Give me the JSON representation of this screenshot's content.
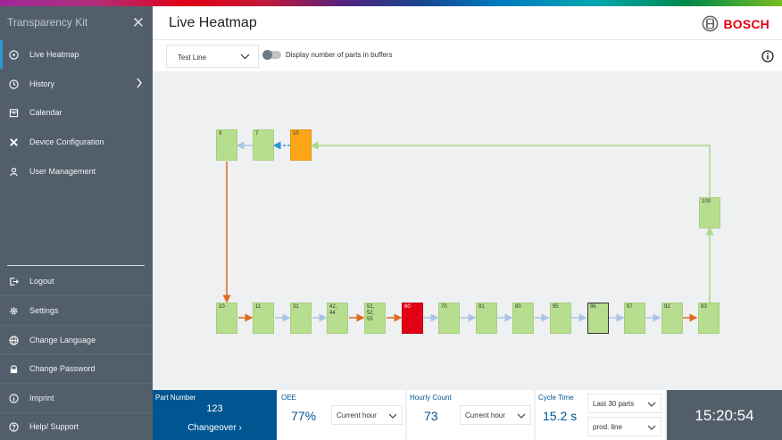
{
  "sidebar": {
    "title": "Transparency Kit",
    "items": [
      {
        "label": "Live Heatmap"
      },
      {
        "label": "History"
      },
      {
        "label": "Calendar"
      },
      {
        "label": "Device Configuration"
      },
      {
        "label": "User Management"
      }
    ],
    "bottom_items": [
      {
        "label": "Logout"
      },
      {
        "label": "Settings"
      },
      {
        "label": "Change Language"
      },
      {
        "label": "Change Password"
      },
      {
        "label": "Imprint"
      },
      {
        "label": "Help/ Support"
      }
    ]
  },
  "header": {
    "title": "Live Heatmap",
    "brand": "BOSCH"
  },
  "toolbar": {
    "line_select": "Test Line",
    "toggle_label": "Display number of parts in buffers",
    "toggle_on": false
  },
  "heatmap": {
    "stations": [
      {
        "label": "9",
        "status": "ok"
      },
      {
        "label": "7",
        "status": "ok"
      },
      {
        "label": "10",
        "status": "warning"
      },
      {
        "label": "100",
        "status": "ok"
      },
      {
        "label": "10",
        "status": "ok"
      },
      {
        "label": "11",
        "status": "ok"
      },
      {
        "label": "31",
        "status": "ok"
      },
      {
        "label": "42,\n44",
        "status": "ok"
      },
      {
        "label": "51,\n52,\n55",
        "status": "ok"
      },
      {
        "label": "60",
        "status": "error"
      },
      {
        "label": "70",
        "status": "ok"
      },
      {
        "label": "91",
        "status": "ok"
      },
      {
        "label": "80",
        "status": "ok"
      },
      {
        "label": "95",
        "status": "ok"
      },
      {
        "label": "96",
        "status": "selected"
      },
      {
        "label": "97",
        "status": "ok"
      },
      {
        "label": "92",
        "status": "ok"
      },
      {
        "label": "93",
        "status": "ok"
      }
    ],
    "colors": {
      "ok": "#b7de8e",
      "warning": "#fba617",
      "error": "#e20015",
      "flow_green": "#a9d88a",
      "flow_blue": "#a9c4e6",
      "flow_orange": "#e06a1f",
      "flow_dashed": "#2b9ad7"
    }
  },
  "kpi": {
    "part_number_label": "Part Number",
    "part_number": "123",
    "changeover_label": "Changeover",
    "oee_label": "OEE",
    "oee_value": "77%",
    "oee_period": "Current hour",
    "hourly_label": "Hourly Count",
    "hourly_value": "73",
    "hourly_period": "Current hour",
    "cycle_label": "Cycle Time",
    "cycle_value": "15.2 s",
    "cycle_range": "Last 30 parts",
    "cycle_scope": "prod. line",
    "clock": "15:20:54"
  }
}
